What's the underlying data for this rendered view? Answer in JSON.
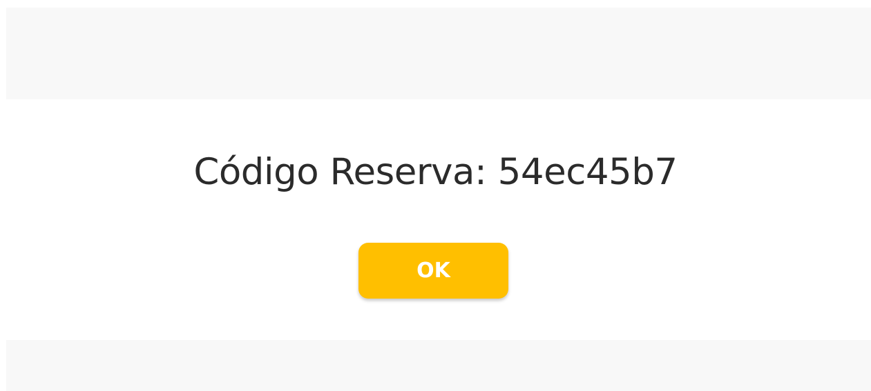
{
  "dialog": {
    "message": "Código Reserva: 54ec45b7",
    "ok_label": "OK"
  },
  "colors": {
    "button_background": "#ffbf00",
    "button_text": "#ffffff",
    "message_text": "#2b2b2b",
    "band_background": "#f8f8f8"
  }
}
